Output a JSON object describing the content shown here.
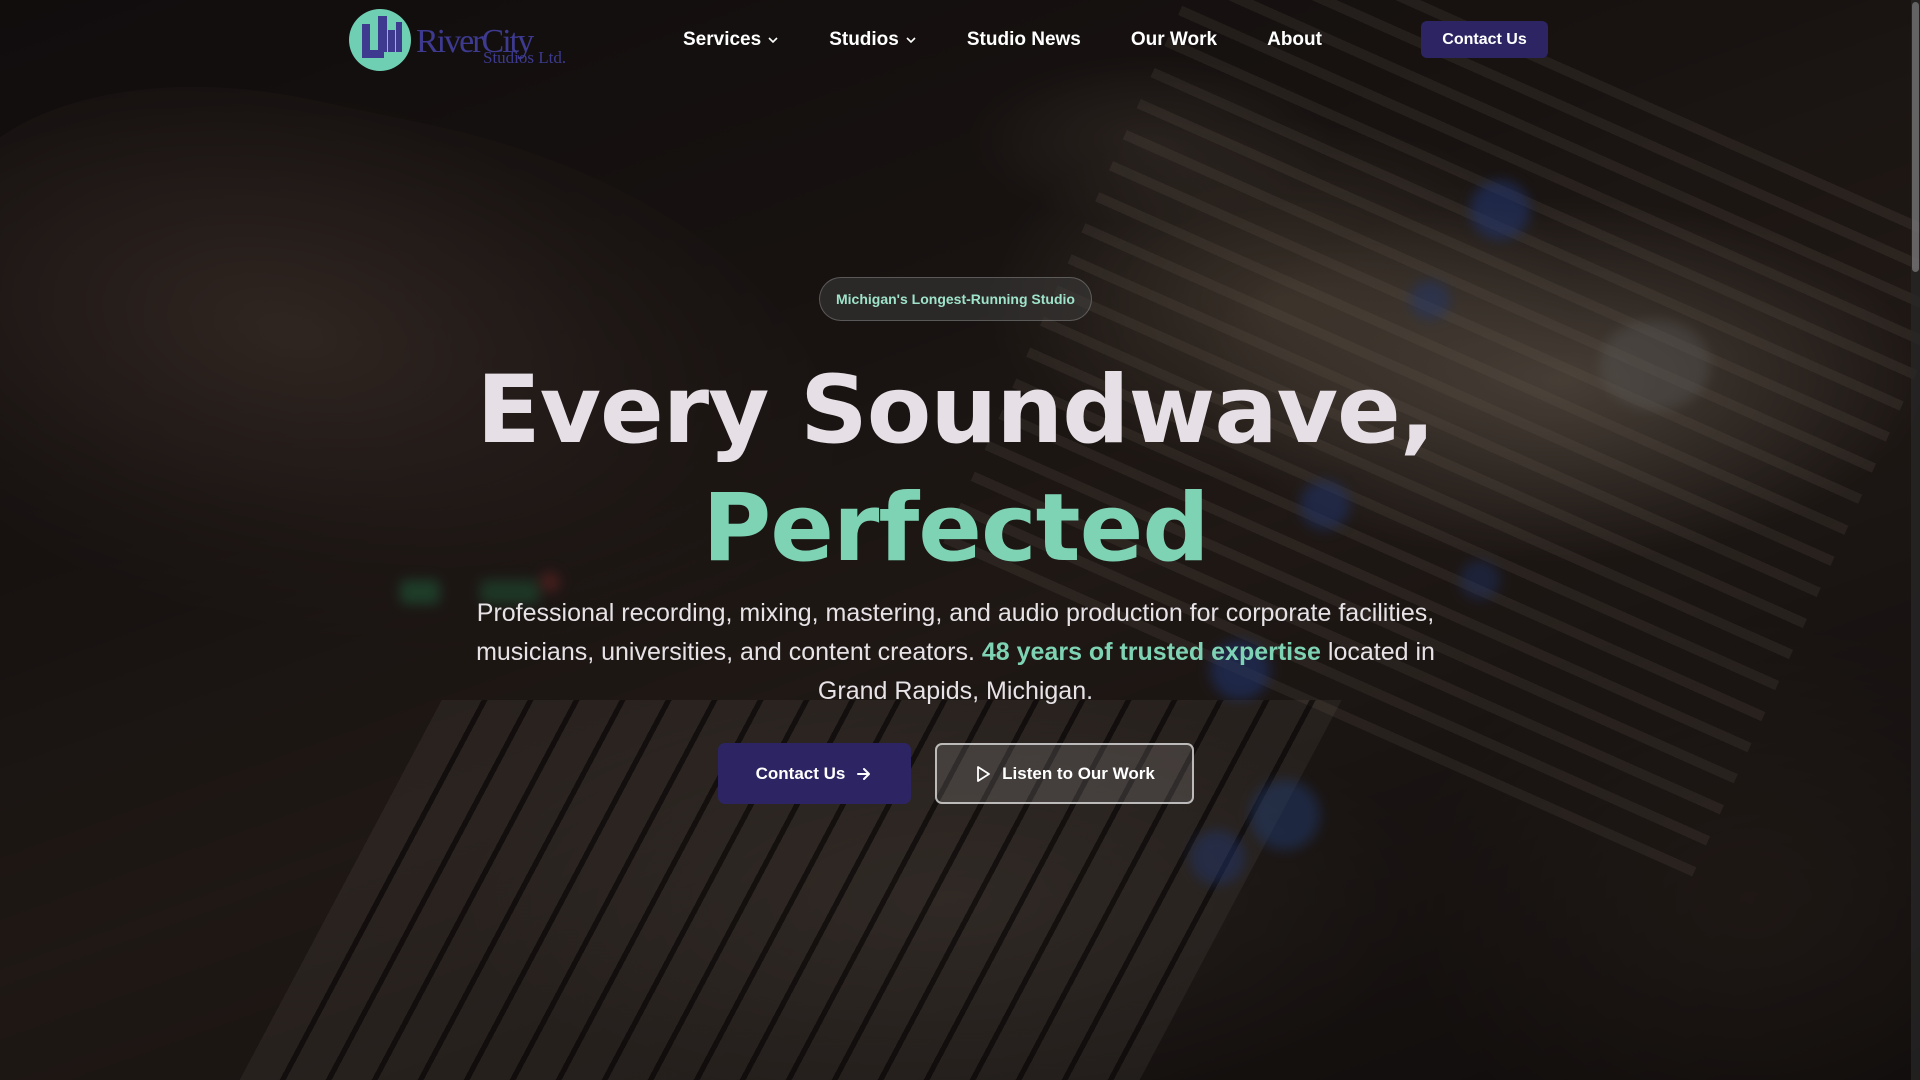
{
  "brand": {
    "logo_text_main": "RiverCity",
    "logo_text_sub": "Studios Ltd.",
    "logo_colors": {
      "circle": "#6fcfb3",
      "text": "#3d3a8f"
    }
  },
  "nav": {
    "items": [
      {
        "label": "Services",
        "has_dropdown": true
      },
      {
        "label": "Studios",
        "has_dropdown": true
      },
      {
        "label": "Studio News",
        "has_dropdown": false
      },
      {
        "label": "Our Work",
        "has_dropdown": false
      },
      {
        "label": "About",
        "has_dropdown": false
      }
    ],
    "cta_label": "Contact Us"
  },
  "hero": {
    "badge": "Michigan's Longest-Running Studio",
    "headline_line1": "Every Soundwave,",
    "headline_line2": "Perfected",
    "sub_before": "Professional recording, mixing, mastering, and audio production for corporate facilities, musicians, universities, and content creators. ",
    "sub_highlight": "48 years of trusted expertise",
    "sub_after": " located in Grand Rapids, Michigan.",
    "primary_button": "Contact Us",
    "primary_icon": "arrow-right-icon",
    "secondary_button": "Listen to Our Work",
    "secondary_icon": "play-icon"
  },
  "colors": {
    "accent": "#7fd3b5",
    "button_primary": "#2d2563",
    "headline": "#e6e0e6"
  }
}
